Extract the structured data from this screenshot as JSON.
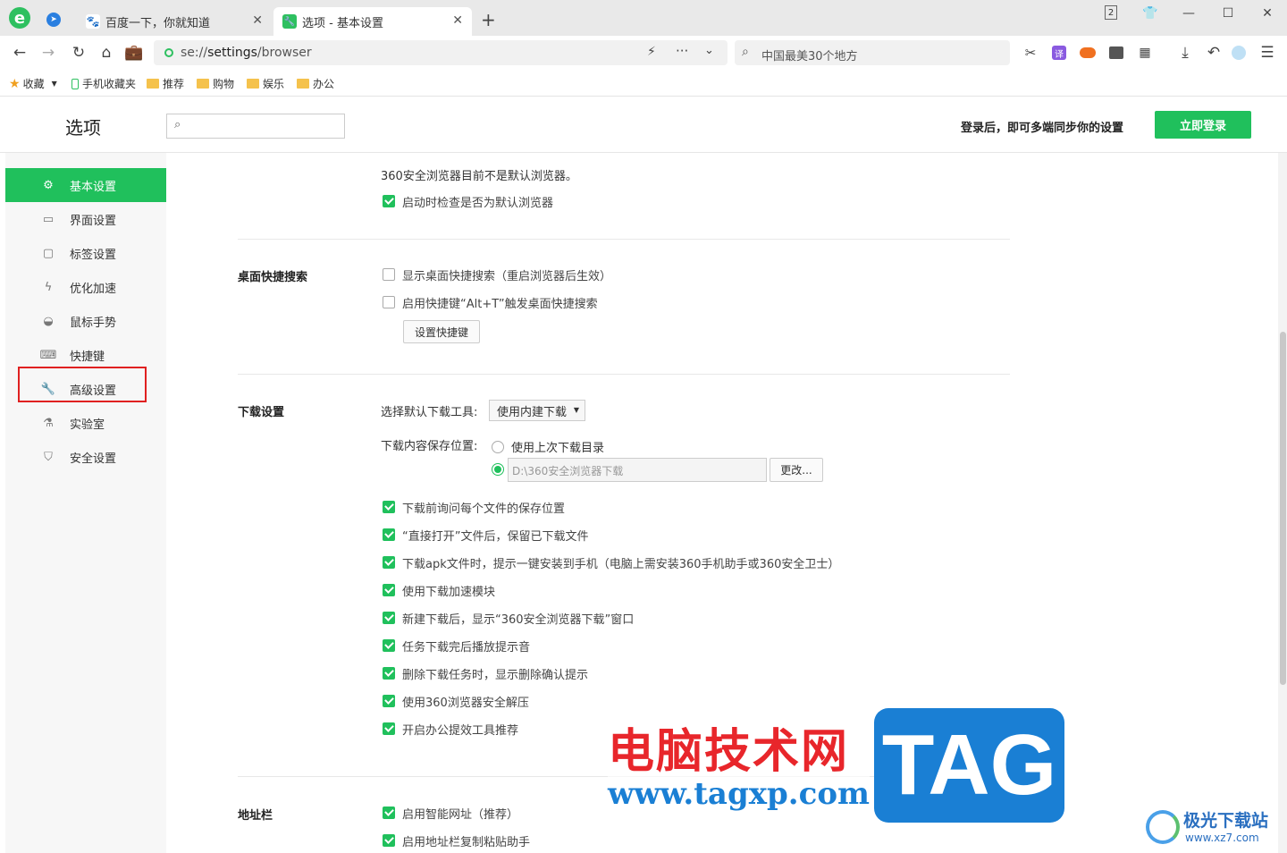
{
  "tabs": [
    {
      "title": "百度一下，你就知道",
      "active": false
    },
    {
      "title": "选项 - 基本设置",
      "active": true
    }
  ],
  "tab_counter": "2",
  "address": {
    "url_prefix": "se://",
    "url_main": "settings",
    "url_suffix": "/browser"
  },
  "search": {
    "placeholder": "中国最美30个地方"
  },
  "bookmarks": {
    "favorites": "收藏",
    "mobile": "手机收藏夹",
    "folders": [
      "推荐",
      "购物",
      "娱乐",
      "办公"
    ]
  },
  "header": {
    "title": "选项",
    "sync_text": "登录后，即可多端同步你的设置",
    "login_button": "立即登录"
  },
  "sidebar": {
    "items": [
      {
        "label": "基本设置",
        "icon": "gear-icon"
      },
      {
        "label": "界面设置",
        "icon": "window-icon"
      },
      {
        "label": "标签设置",
        "icon": "tab-icon"
      },
      {
        "label": "优化加速",
        "icon": "lightning-icon"
      },
      {
        "label": "鼠标手势",
        "icon": "mouse-icon"
      },
      {
        "label": "快捷键",
        "icon": "keyboard-icon"
      },
      {
        "label": "高级设置",
        "icon": "wrench-icon"
      },
      {
        "label": "实验室",
        "icon": "flask-icon"
      },
      {
        "label": "安全设置",
        "icon": "shield-icon"
      }
    ],
    "active_index": 0,
    "highlighted_index": 6
  },
  "default_browser": {
    "notice": "360安全浏览器目前不是默认浏览器。",
    "check_on_start": "启动时检查是否为默认浏览器"
  },
  "desktop_search": {
    "title": "桌面快捷搜索",
    "show": "显示桌面快捷搜索（重启浏览器后生效）",
    "hotkey": "启用快捷键“Alt+T”触发桌面快捷搜索",
    "set_hotkey_button": "设置快捷键"
  },
  "download": {
    "title": "下载设置",
    "tool_label": "选择默认下载工具:",
    "tool_value": "使用内建下载",
    "location_label": "下载内容保存位置:",
    "option_last": "使用上次下载目录",
    "path_value": "D:\\360安全浏览器下载",
    "change_button": "更改...",
    "options": [
      "下载前询问每个文件的保存位置",
      "“直接打开”文件后，保留已下载文件",
      "下载apk文件时，提示一键安装到手机（电脑上需安装360手机助手或360安全卫士）",
      "使用下载加速模块",
      "新建下载后，显示“360安全浏览器下载”窗口",
      "任务下载完后播放提示音",
      "删除下载任务时，显示删除确认提示",
      "使用360浏览器安全解压",
      "开启办公提效工具推荐"
    ]
  },
  "addressbar": {
    "title": "地址栏",
    "options": [
      "启用智能网址（推荐）",
      "启用地址栏复制粘贴助手"
    ]
  },
  "watermark": {
    "cn_text": "电脑技术网",
    "url_text": "www.tagxp.com",
    "tag_text": "TAG",
    "corner_text": "极光下载站",
    "corner_url": "www.xz7.com"
  },
  "colors": {
    "accent": "#20c05c",
    "highlight_box": "#e02020",
    "watermark_red": "#e8262b",
    "watermark_blue": "#1a7fd4"
  }
}
